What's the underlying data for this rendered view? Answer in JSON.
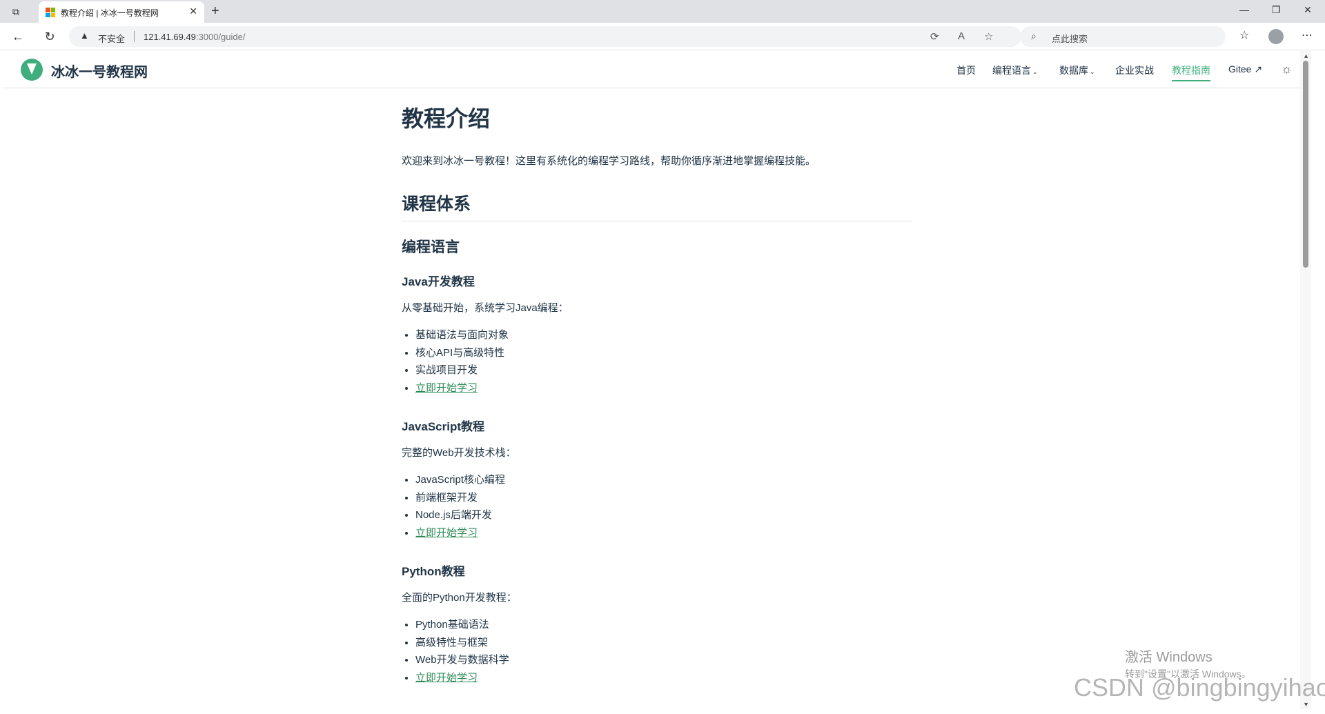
{
  "browser": {
    "tab_title": "教程介绍 | 冰冰一号教程网",
    "security_label": "不安全",
    "url_host": "121.41.69.49",
    "url_rest": ":3000/guide/",
    "search_placeholder": "点此搜索"
  },
  "site": {
    "title": "冰冰一号教程网",
    "nav": [
      {
        "label": "首页"
      },
      {
        "label": "编程语言",
        "dropdown": true
      },
      {
        "label": "数据库",
        "dropdown": true
      },
      {
        "label": "企业实战"
      },
      {
        "label": "教程指南",
        "active": true
      },
      {
        "label": "Gitee ↗"
      }
    ],
    "accent_color": "#3eaf7c"
  },
  "content": {
    "title": "教程介绍",
    "intro": "欢迎来到冰冰一号教程！这里有系统化的编程学习路线，帮助你循序渐进地掌握编程技能。",
    "section_title": "课程体系",
    "subsection_title": "编程语言",
    "courses": [
      {
        "title": "Java开发教程",
        "desc": "从零基础开始，系统学习Java编程：",
        "items": [
          "基础语法与面向对象",
          "核心API与高级特性",
          "实战项目开发"
        ],
        "link": "立即开始学习"
      },
      {
        "title": "JavaScript教程",
        "desc": "完整的Web开发技术栈：",
        "items": [
          "JavaScript核心编程",
          "前端框架开发",
          "Node.js后端开发"
        ],
        "link": "立即开始学习"
      },
      {
        "title": "Python教程",
        "desc": "全面的Python开发教程：",
        "items": [
          "Python基础语法",
          "高级特性与框架",
          "Web开发与数据科学"
        ],
        "link": "立即开始学习"
      }
    ]
  },
  "overlay": {
    "activate_title": "激活 Windows",
    "activate_sub": "转到\"设置\"以激活 Windows。",
    "watermark": "CSDN @bingbingyihao"
  }
}
